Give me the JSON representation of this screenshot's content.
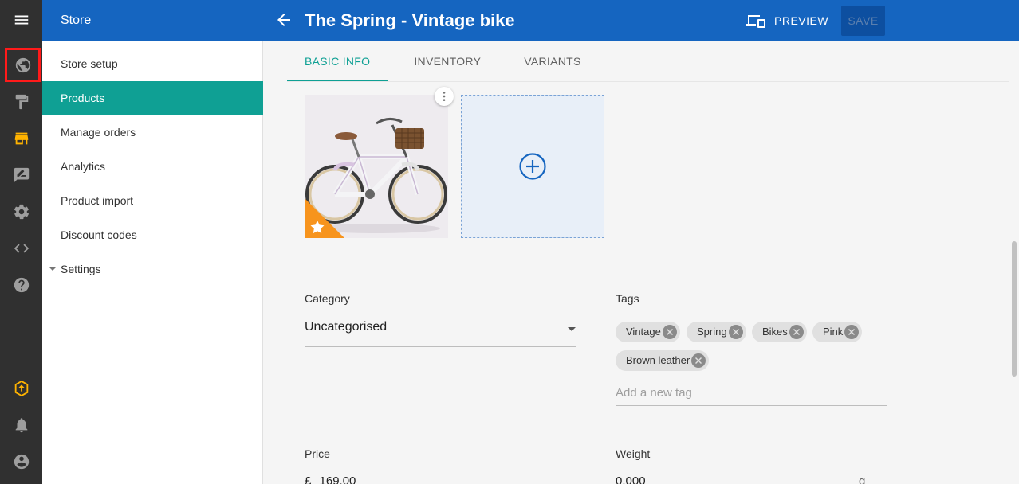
{
  "rail": {
    "items": [
      "menu-icon",
      "globe-icon",
      "paint-roller-icon",
      "store-icon",
      "feedback-icon",
      "gear-icon",
      "code-icon",
      "help-icon",
      "upgrade-icon",
      "bell-icon",
      "account-icon"
    ],
    "active": "store-icon",
    "active_color": "#ffb300"
  },
  "header": {
    "store_title": "Store",
    "page_title": "The Spring - Vintage bike",
    "preview_label": "PREVIEW",
    "save_label": "SAVE",
    "color": "#1565c0"
  },
  "sidebar": {
    "items": [
      {
        "label": "Store setup"
      },
      {
        "label": "Products",
        "active": true
      },
      {
        "label": "Manage orders"
      },
      {
        "label": "Analytics"
      },
      {
        "label": "Product import"
      },
      {
        "label": "Discount codes"
      },
      {
        "label": "Settings",
        "expandable": true
      }
    ],
    "active_color": "#0fa094"
  },
  "tabs": [
    {
      "label": "BASIC INFO",
      "active": true
    },
    {
      "label": "INVENTORY"
    },
    {
      "label": "VARIANTS"
    }
  ],
  "images": {
    "main_image": "vintage-bike-photo",
    "featured_badge": "star-icon",
    "add_image": "add-circle-icon"
  },
  "category": {
    "label": "Category",
    "value": "Uncategorised"
  },
  "tags": {
    "label": "Tags",
    "chips": [
      "Vintage",
      "Spring",
      "Bikes",
      "Pink",
      "Brown leather"
    ],
    "placeholder": "Add a new tag"
  },
  "price": {
    "label": "Price",
    "currency": "£",
    "value": "169.00"
  },
  "weight": {
    "label": "Weight",
    "value": "0.000",
    "unit": "g"
  }
}
